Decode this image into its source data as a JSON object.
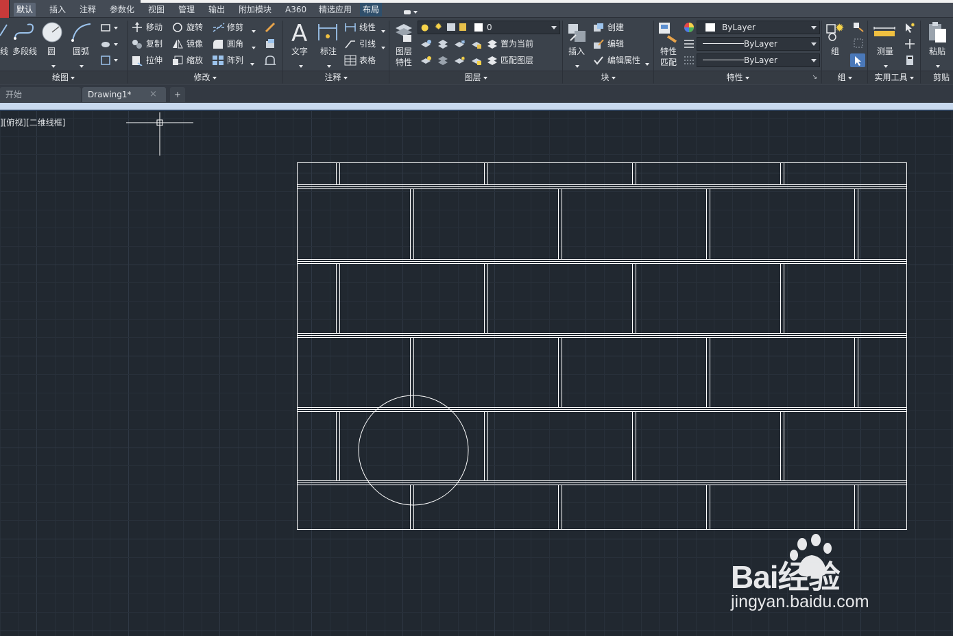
{
  "menu": {
    "tabs": [
      "默认",
      "插入",
      "注释",
      "参数化",
      "视图",
      "管理",
      "输出",
      "附加模块",
      "A360",
      "精选应用",
      "布局"
    ],
    "active": "默认",
    "highlighted": "布局"
  },
  "ribbon": {
    "draw": {
      "footer": "绘图",
      "line_label": "线",
      "polyline_label": "多段线",
      "circle_label": "圆",
      "arc_label": "圆弧"
    },
    "modify": {
      "footer": "修改",
      "move": "移动",
      "rotate": "旋转",
      "trim": "修剪",
      "copy": "复制",
      "mirror": "镜像",
      "fillet": "圆角",
      "stretch": "拉伸",
      "scale": "缩放",
      "array": "阵列"
    },
    "annotation": {
      "footer": "注释",
      "text": "文字",
      "dimension": "标注",
      "linear": "线性",
      "leader": "引线",
      "table": "表格"
    },
    "layers": {
      "footer": "图层",
      "layer_properties_1": "图层",
      "layer_properties_2": "特性",
      "current_layer": "0",
      "set_current": "置为当前",
      "match_layer": "匹配图层"
    },
    "block": {
      "footer": "块",
      "insert": "插入",
      "create": "创建",
      "edit": "编辑",
      "edit_attributes": "编辑属性"
    },
    "properties": {
      "footer": "特性",
      "match_1": "特性",
      "match_2": "匹配",
      "color": "ByLayer",
      "linetype": "ByLayer",
      "lineweight": "ByLayer"
    },
    "groups": {
      "footer": "组",
      "group": "组"
    },
    "utilities": {
      "footer": "实用工具",
      "measure": "测量"
    },
    "clipboard": {
      "footer": "剪贴板",
      "paste": "粘贴"
    }
  },
  "doc_tabs": {
    "start": "开始",
    "drawing": "Drawing1*",
    "close": "×",
    "add": "+"
  },
  "viewport": {
    "label": "][俯视][二维线框]"
  },
  "watermark": {
    "brand": "Bai经验",
    "url": "jingyan.baidu.com"
  },
  "colors": {
    "canvas_bg": "#212830",
    "ribbon_bg": "#3b424b",
    "menubar_bg": "#444b55",
    "accent_bar": "#c8d9ee",
    "drawing_lines": "#ffffff"
  }
}
